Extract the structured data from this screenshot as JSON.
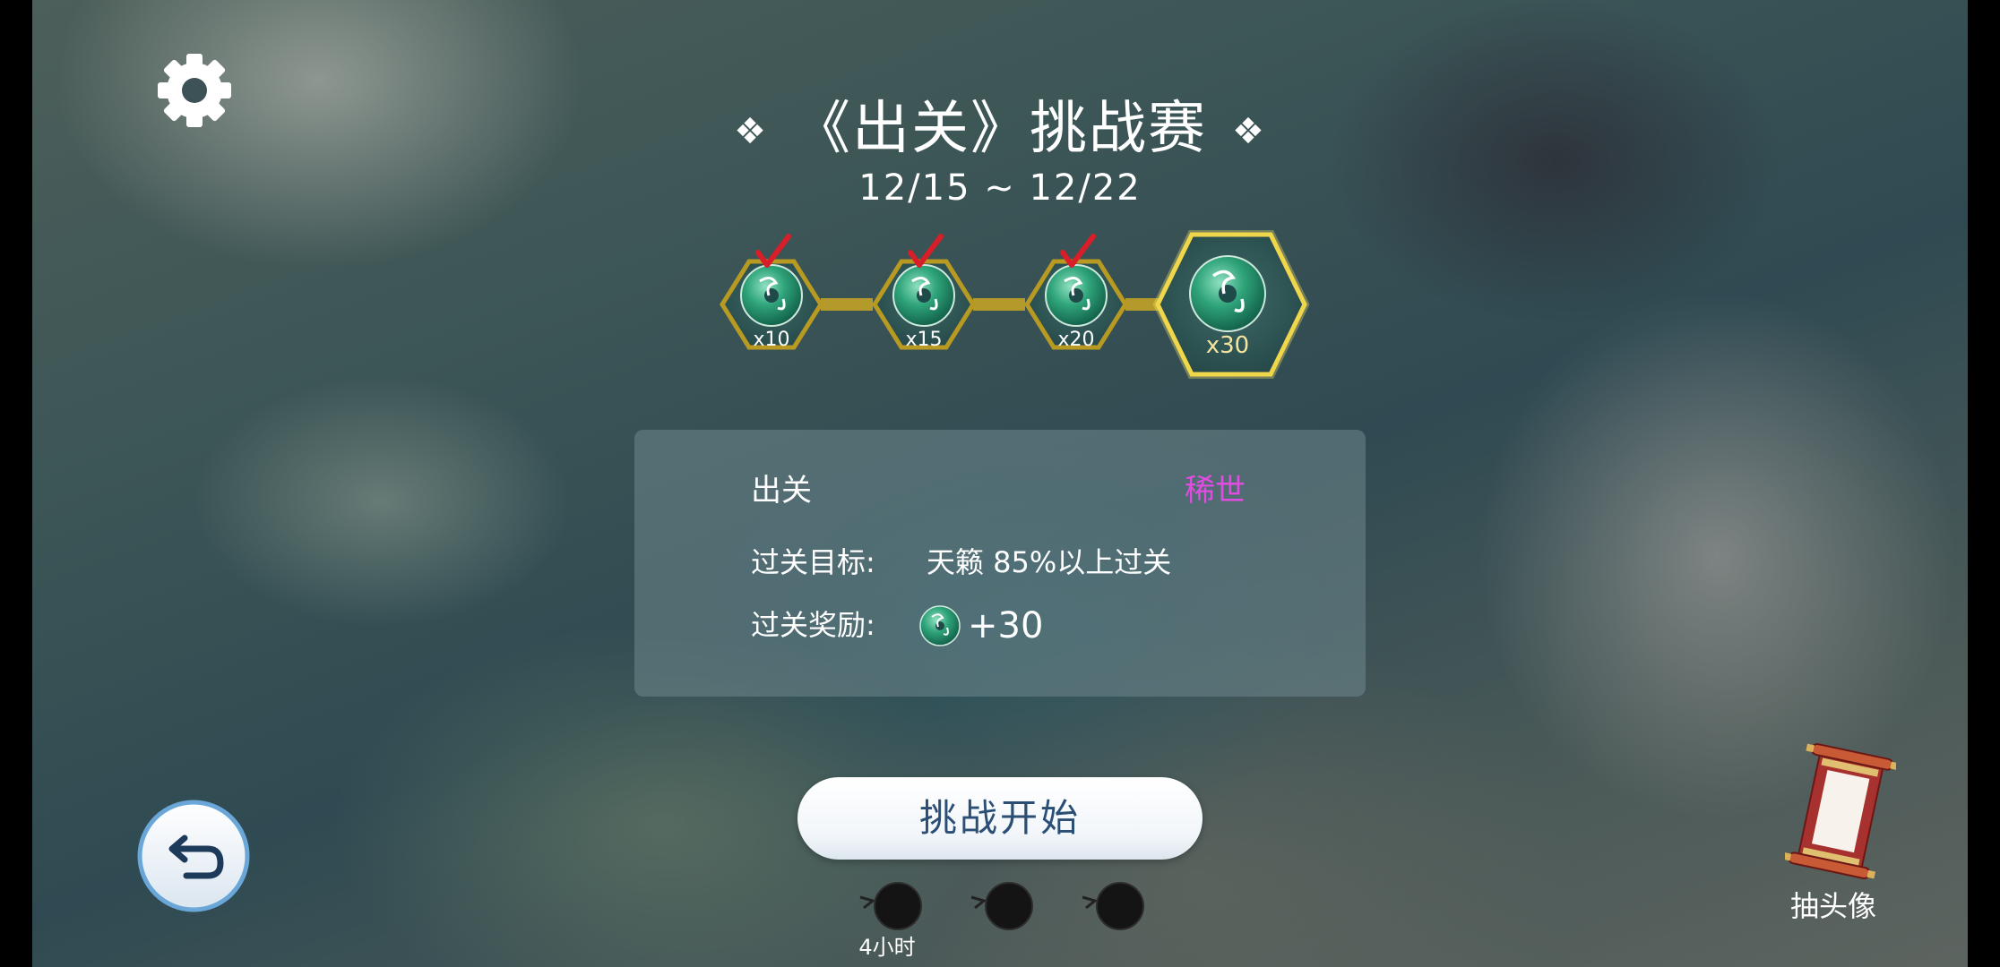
{
  "header": {
    "title": "《出关》挑战赛",
    "ornament": "❖",
    "dates": "12/15 ~ 12/22"
  },
  "milestones": [
    {
      "label": "x10",
      "completed": true
    },
    {
      "label": "x15",
      "completed": true
    },
    {
      "label": "x20",
      "completed": true
    },
    {
      "label": "x30",
      "completed": false,
      "current": true
    }
  ],
  "challenge": {
    "song_name": "出关",
    "rarity": "稀世",
    "goal_label": "过关目标:",
    "goal_value": "天籁 85%以上过关",
    "reward_label": "过关奖励:",
    "reward_value": "+30"
  },
  "start_button": {
    "label": "挑战开始"
  },
  "stamina": {
    "slots": 3,
    "timer": "4小时"
  },
  "draw_avatar": {
    "label": "抽头像"
  },
  "icons": {
    "settings": "gear-icon",
    "back": "return-arrow-icon",
    "reward": "jade-disc-icon",
    "draw": "scroll-icon"
  },
  "colors": {
    "rarity": "#e24ce0",
    "gold": "#e8c62c",
    "button_text": "#2b4e75",
    "check": "#d81e28"
  }
}
